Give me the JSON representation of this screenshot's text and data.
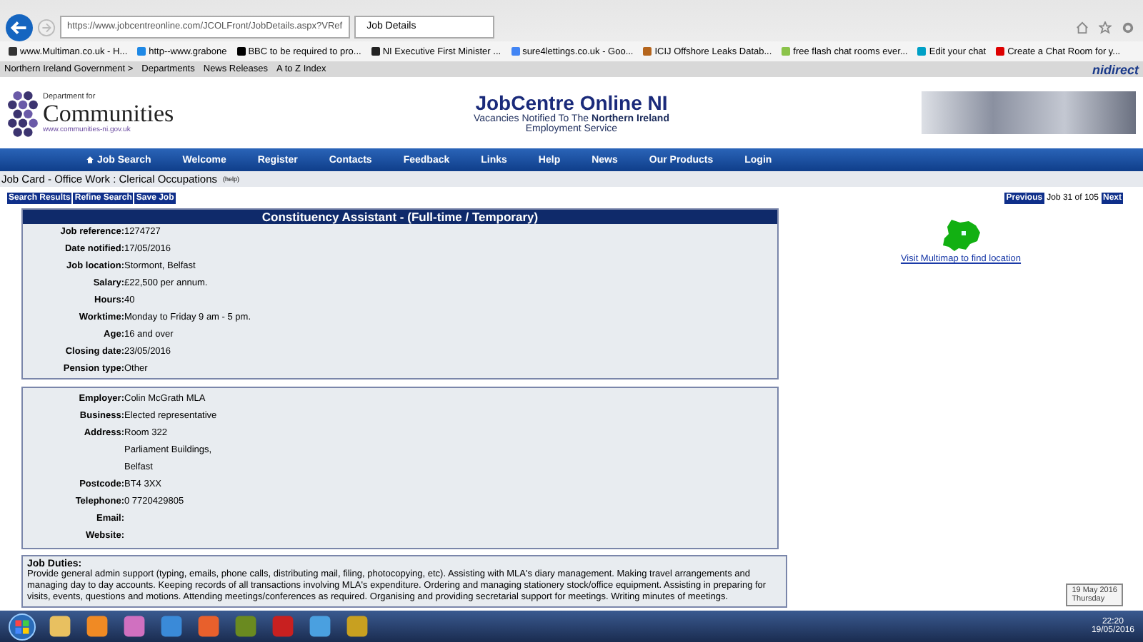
{
  "browser": {
    "url": "https://www.jobcentreonline.com/JCOLFront/JobDetails.aspx?VRef",
    "tab_title": "Job Details",
    "favorites": [
      "www.Multiman.co.uk - H...",
      "http--www.grabone",
      "BBC to be required to pro...",
      "NI Executive First Minister ...",
      "sure4lettings.co.uk - Goo...",
      "ICIJ Offshore Leaks Datab...",
      "free flash chat rooms ever...",
      "Edit your chat",
      "Create a Chat Room for y..."
    ],
    "site_links": [
      "Northern Ireland Government >",
      "Departments",
      "News Releases",
      "A to Z Index"
    ],
    "brand": "nidirect"
  },
  "header": {
    "dept_prefix": "Department for",
    "dept_name": "Communities",
    "dept_url": "www.communities-ni.gov.uk",
    "title": "JobCentre Online NI",
    "subtitle": "Vacancies Notified To The **Northern Ireland**",
    "subtitle_2": "Employment Service"
  },
  "nav": [
    "Job Search",
    "Welcome",
    "Register",
    "Contacts",
    "Feedback",
    "Links",
    "Help",
    "News",
    "Our Products",
    "Login"
  ],
  "breadcrumb": {
    "text": "Job Card - Office Work : Clerical Occupations",
    "help": "(help)"
  },
  "actions": [
    "Search Results",
    "Refine Search",
    "Save Job"
  ],
  "pager": {
    "previous": "Previous",
    "position": "Job 31 of 105",
    "next": "Next"
  },
  "job": {
    "title": "Constituency Assistant - (Full-time / Temporary)",
    "fields": [
      {
        "label": "Job reference:",
        "value": [
          "1274727"
        ]
      },
      {
        "label": "Date notified:",
        "value": [
          "17/05/2016"
        ]
      },
      {
        "label": "Job location:",
        "value": [
          "Stormont, Belfast"
        ]
      },
      {
        "label": "Salary:",
        "value": [
          "£22,500 per annum."
        ]
      },
      {
        "label": "Hours:",
        "value": [
          "40"
        ]
      },
      {
        "label": "Worktime:",
        "value": [
          "Monday to Friday 9 am - 5 pm."
        ]
      },
      {
        "label": "Age:",
        "value": [
          "16 and over"
        ]
      },
      {
        "label": "Closing date:",
        "value": [
          "23/05/2016"
        ]
      },
      {
        "label": "Pension type:",
        "value": [
          "Other"
        ]
      }
    ]
  },
  "contact": {
    "fields": [
      {
        "label": "Employer:",
        "value": [
          "Colin McGrath MLA"
        ]
      },
      {
        "label": "Business:",
        "value": [
          "Elected representative"
        ]
      },
      {
        "label": "Address:",
        "value": [
          "Room 322",
          "Parliament Buildings,",
          "Belfast"
        ]
      },
      {
        "label": "Postcode:",
        "value": [
          "BT4 3XX"
        ]
      },
      {
        "label": "Telephone:",
        "value": [
          "0 7720429805"
        ]
      },
      {
        "label": "Email:"
      },
      {
        "label": "Website:"
      }
    ]
  },
  "map_link": "Visit Multimap to find location",
  "duties": {
    "heading": "Job Duties:",
    "text": "Provide general admin support (typing, emails, phone calls, distributing mail, filing, photocopying, etc). Assisting with MLA's diary management. Making travel arrangements and managing day to day accounts. Keeping records of all transactions involving MLA's expenditure. Ordering and managing stationery stock/office equipment. Assisting in preparing for visits, events, questions and motions. Attending meetings/conferences as required. Organising and providing secretarial support for meetings. Writing minutes of meetings."
  },
  "tooltip": {
    "date": "19 May 2016",
    "day": "Thursday"
  },
  "clock": {
    "time": "22:20",
    "date": "19/05/2016"
  }
}
